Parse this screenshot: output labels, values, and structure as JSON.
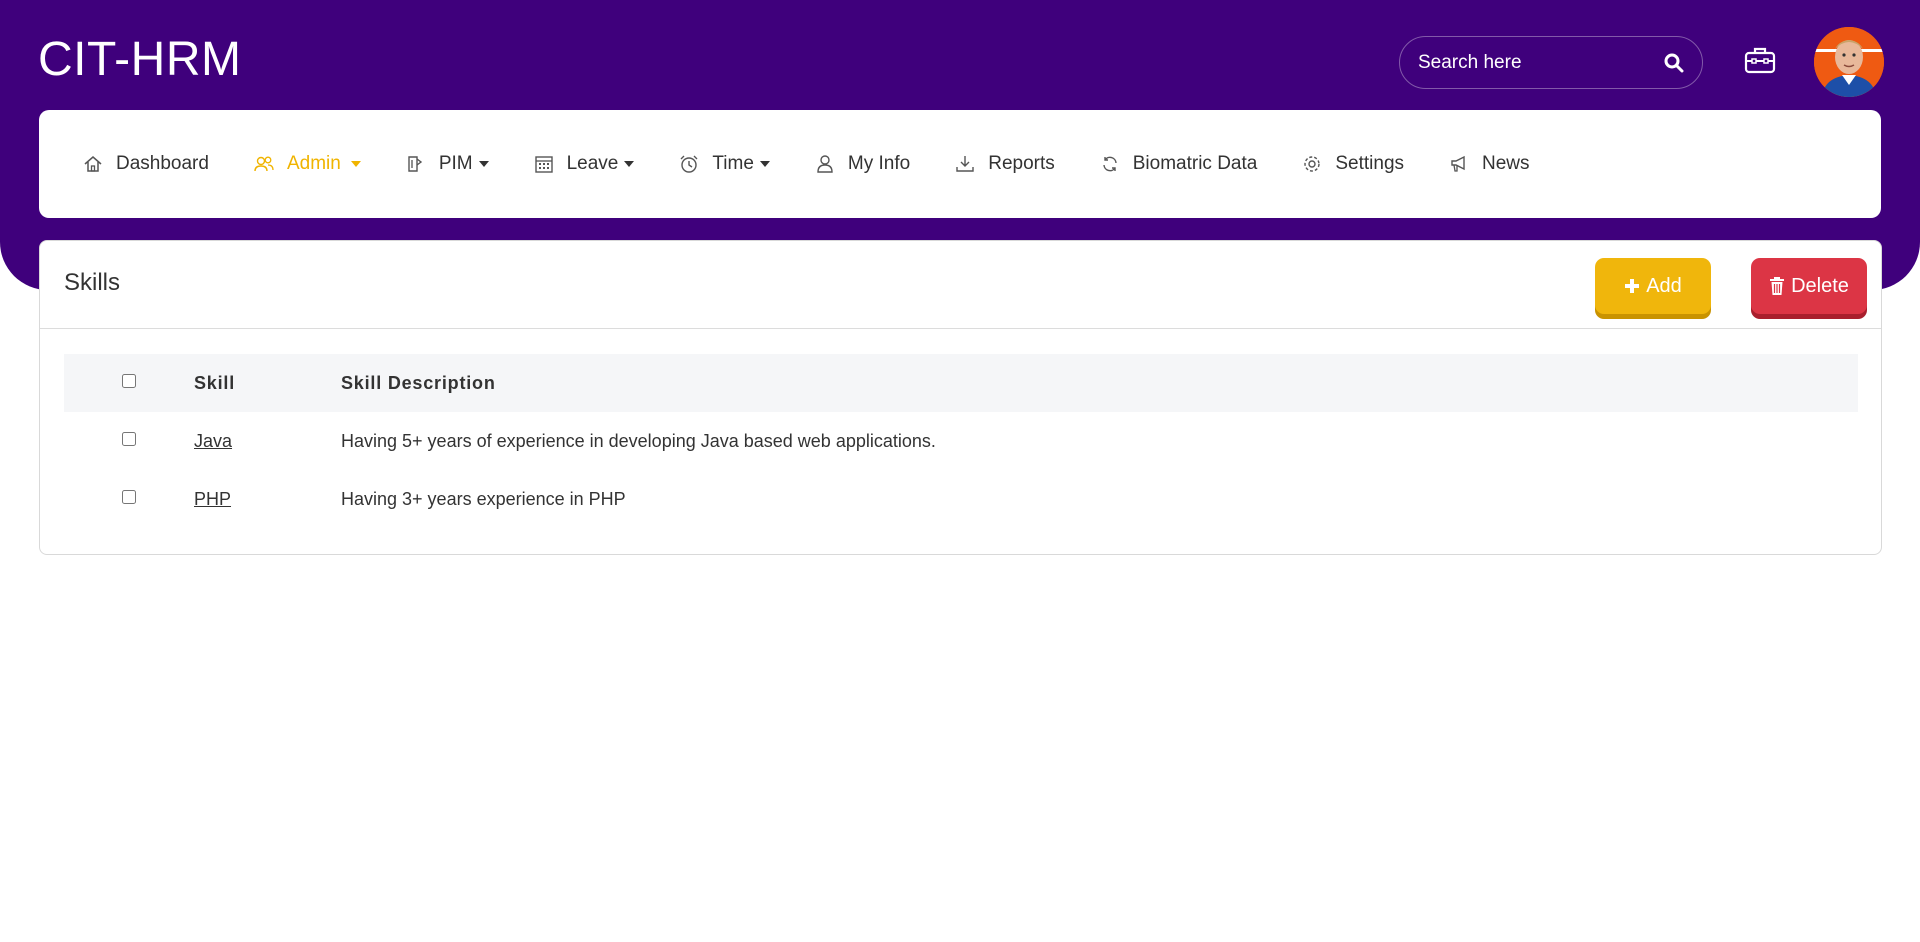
{
  "app": {
    "brand": "CIT-HRM"
  },
  "header": {
    "search_placeholder": "Search here",
    "icons": [
      "search-icon",
      "briefcase-icon"
    ],
    "avatar_alt": "User avatar"
  },
  "nav": {
    "dashboard": "Dashboard",
    "admin": "Admin",
    "pim": "PIM",
    "leave": "Leave",
    "time": "Time",
    "myinfo": "My Info",
    "reports": "Reports",
    "biomatric": "Biomatric Data",
    "settings": "Settings",
    "news": "News",
    "active": "Admin"
  },
  "page": {
    "title": "Skills",
    "add_label": "Add",
    "delete_label": "Delete"
  },
  "table": {
    "headers": {
      "skill": "Skill",
      "description": "Skill Description"
    },
    "rows": [
      {
        "skill": "Java",
        "description": "Having 5+ years of experience in developing Java based web applications."
      },
      {
        "skill": "PHP",
        "description": "Having 3+ years experience in PHP"
      }
    ]
  },
  "colors": {
    "header_bg": "#3f007c",
    "accent": "#f0b400",
    "add_button": "#f0b60c",
    "delete_button": "#dc3545"
  }
}
